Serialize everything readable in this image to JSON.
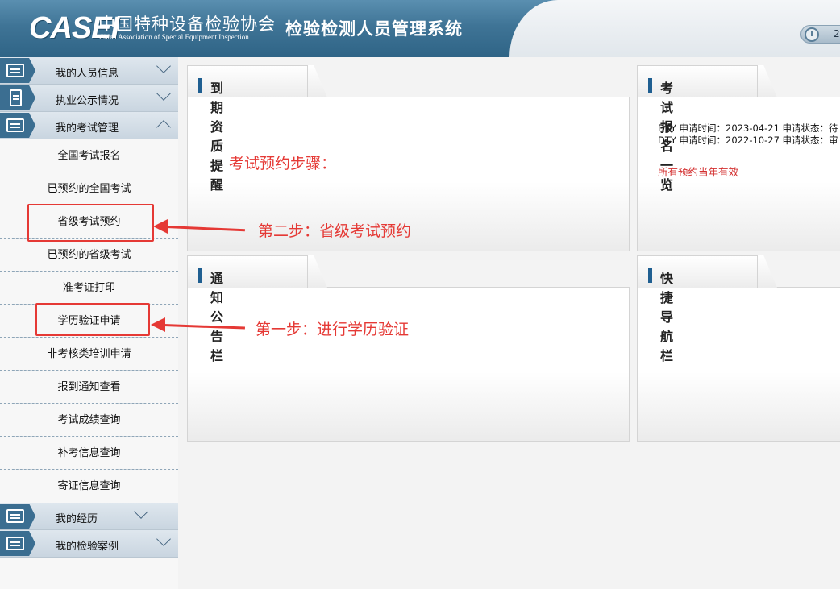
{
  "header": {
    "logo_text": "CASEI",
    "org_name_cn": "中国特种设备检验协会",
    "org_name_en": "China Association of Special Equipment Inspection",
    "system_title": "检验检测人员管理系统",
    "clock_text": "2"
  },
  "sidebar": {
    "sections": [
      {
        "label": "我的人员信息",
        "icon": "id-card-icon",
        "expanded": false
      },
      {
        "label": "执业公示情况",
        "icon": "document-icon",
        "expanded": false
      },
      {
        "label": "我的考试管理",
        "icon": "list-card-icon",
        "expanded": true
      },
      {
        "label": "我的经历",
        "icon": "id-card-icon",
        "expanded": false
      },
      {
        "label": "我的检验案例",
        "icon": "list-card-icon",
        "expanded": false
      }
    ],
    "exam_items": [
      "全国考试报名",
      "已预约的全国考试",
      "省级考试预约",
      "已预约的省级考试",
      "准考证打印",
      "学历验证申请",
      "非考核类培训申请",
      "报到通知查看",
      "考试成绩查询",
      "补考信息查询",
      "寄证信息查询"
    ]
  },
  "panels": {
    "expiry_reminder": {
      "title": "到期资质提醒"
    },
    "exam_overview": {
      "title": "考试报名一览",
      "entries": [
        "DTY  申请时间：2023-04-21 申请状态：待",
        "DTY  申请时间：2022-10-27 申请状态：审"
      ],
      "note": "所有预约当年有效"
    },
    "notice_board": {
      "title": "通知公告栏"
    },
    "quick_nav": {
      "title": "快捷导航栏"
    }
  },
  "annotations": {
    "heading": "考试预约步骤：",
    "step2": "第二步：省级考试预约",
    "step1": "第一步：进行学历验证"
  },
  "colors": {
    "header_blue": "#3f7496",
    "accent_bar": "#1f5f91",
    "annotation_red": "#e53935"
  }
}
